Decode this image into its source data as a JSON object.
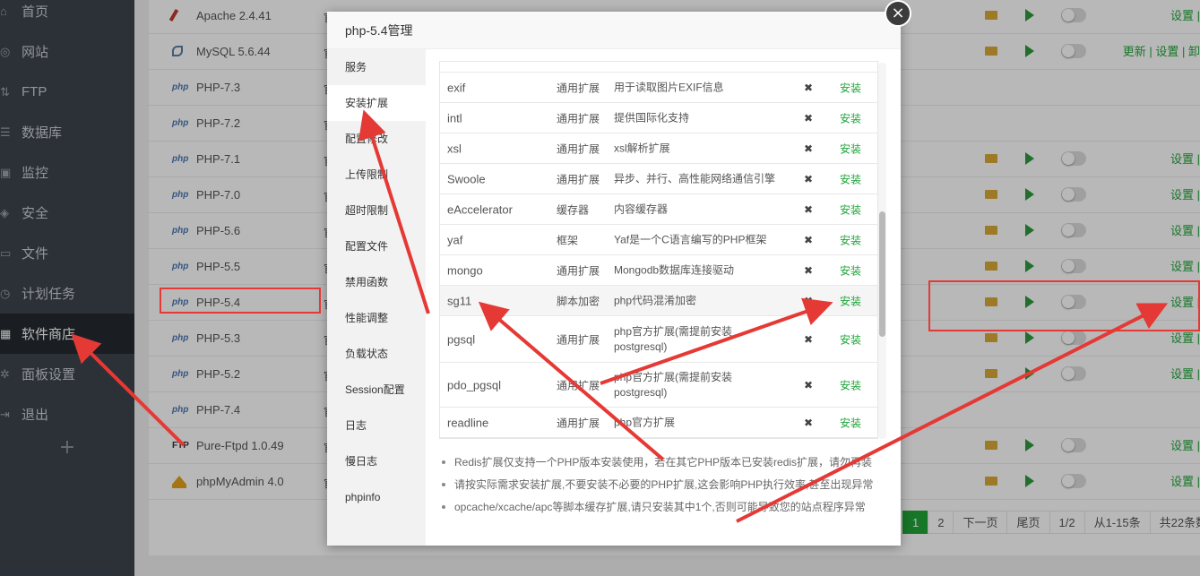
{
  "sidebar": {
    "items": [
      {
        "label": "首页",
        "icon": "home-icon"
      },
      {
        "label": "网站",
        "icon": "globe-icon"
      },
      {
        "label": "FTP",
        "icon": "ftp-icon"
      },
      {
        "label": "数据库",
        "icon": "database-icon"
      },
      {
        "label": "监控",
        "icon": "monitor-icon"
      },
      {
        "label": "安全",
        "icon": "shield-icon"
      },
      {
        "label": "文件",
        "icon": "folder-icon"
      },
      {
        "label": "计划任务",
        "icon": "clock-icon"
      },
      {
        "label": "软件商店",
        "icon": "grid-icon"
      },
      {
        "label": "面板设置",
        "icon": "gear-icon"
      },
      {
        "label": "退出",
        "icon": "exit-icon"
      }
    ],
    "add_label": "+"
  },
  "software_list": {
    "rows": [
      {
        "logo": "feather",
        "name": "Apache 2.4.41",
        "actions": "设置 |"
      },
      {
        "logo": "dolphin",
        "name": "MySQL 5.6.44",
        "actions": "更新 | 设置 | 卸"
      },
      {
        "logo": "php",
        "name": "PHP-7.3",
        "actions": ""
      },
      {
        "logo": "php",
        "name": "PHP-7.2",
        "actions": ""
      },
      {
        "logo": "php",
        "name": "PHP-7.1",
        "actions": "设置 |"
      },
      {
        "logo": "php",
        "name": "PHP-7.0",
        "actions": "设置 |"
      },
      {
        "logo": "php",
        "name": "PHP-5.6",
        "actions": "设置 |"
      },
      {
        "logo": "php",
        "name": "PHP-5.5",
        "actions": "设置 |"
      },
      {
        "logo": "php",
        "name": "PHP-5.4",
        "actions": "设置 |"
      },
      {
        "logo": "php",
        "name": "PHP-5.3",
        "actions": "设置 |"
      },
      {
        "logo": "php",
        "name": "PHP-5.2",
        "actions": "设置 |"
      },
      {
        "logo": "php",
        "name": "PHP-7.4",
        "actions": ""
      },
      {
        "logo": "ftp",
        "name": "Pure-Ftpd 1.0.49",
        "actions": "设置 |"
      },
      {
        "logo": "ship",
        "name": "phpMyAdmin 4.0",
        "actions": "设置 |"
      }
    ],
    "php_logo_text": "php",
    "ftp_logo_text": "FTP",
    "mid_marker": "官"
  },
  "pagination": [
    "1",
    "2",
    "下一页",
    "尾页",
    "1/2",
    "从1-15条",
    "共22条数"
  ],
  "modal": {
    "title": "php-5.4管理",
    "close_icon": "×",
    "nav": [
      "服务",
      "安装扩展",
      "配置修改",
      "上传限制",
      "超时限制",
      "配置文件",
      "禁用函数",
      "性能调整",
      "负载状态",
      "Session配置",
      "日志",
      "慢日志",
      "phpinfo"
    ],
    "extensions": [
      {
        "name": "exif",
        "type": "通用扩展",
        "desc": "用于读取图片EXIF信息",
        "status": "✖",
        "action": "安装"
      },
      {
        "name": "intl",
        "type": "通用扩展",
        "desc": "提供国际化支持",
        "status": "✖",
        "action": "安装"
      },
      {
        "name": "xsl",
        "type": "通用扩展",
        "desc": "xsl解析扩展",
        "status": "✖",
        "action": "安装"
      },
      {
        "name": "Swoole",
        "type": "通用扩展",
        "desc": "异步、并行、高性能网络通信引擎",
        "status": "✖",
        "action": "安装"
      },
      {
        "name": "eAccelerator",
        "type": "缓存器",
        "desc": "内容缓存器",
        "status": "✖",
        "action": "安装"
      },
      {
        "name": "yaf",
        "type": "框架",
        "desc": "Yaf是一个C语言编写的PHP框架",
        "status": "✖",
        "action": "安装"
      },
      {
        "name": "mongo",
        "type": "通用扩展",
        "desc": "Mongodb数据库连接驱动",
        "status": "✖",
        "action": "安装"
      },
      {
        "name": "sg11",
        "type": "脚本加密",
        "desc": "php代码混淆加密",
        "status": "✖",
        "action": "安装"
      },
      {
        "name": "pgsql",
        "type": "通用扩展",
        "desc": "php官方扩展(需提前安装postgresql)",
        "status": "✖",
        "action": "安装"
      },
      {
        "name": "pdo_pgsql",
        "type": "通用扩展",
        "desc": "php官方扩展(需提前安装postgresql)",
        "status": "✖",
        "action": "安装"
      },
      {
        "name": "readline",
        "type": "通用扩展",
        "desc": "php官方扩展",
        "status": "✖",
        "action": "安装"
      }
    ],
    "notes": [
      "Redis扩展仅支持一个PHP版本安装使用，若在其它PHP版本已安装redis扩展，请勿再装",
      "请按实际需求安装扩展,不要安装不必要的PHP扩展,这会影响PHP执行效率,甚至出现异常",
      "opcache/xcache/apc等脚本缓存扩展,请只安装其中1个,否则可能导致您的站点程序异常"
    ]
  },
  "annotation_color": "#e53935"
}
